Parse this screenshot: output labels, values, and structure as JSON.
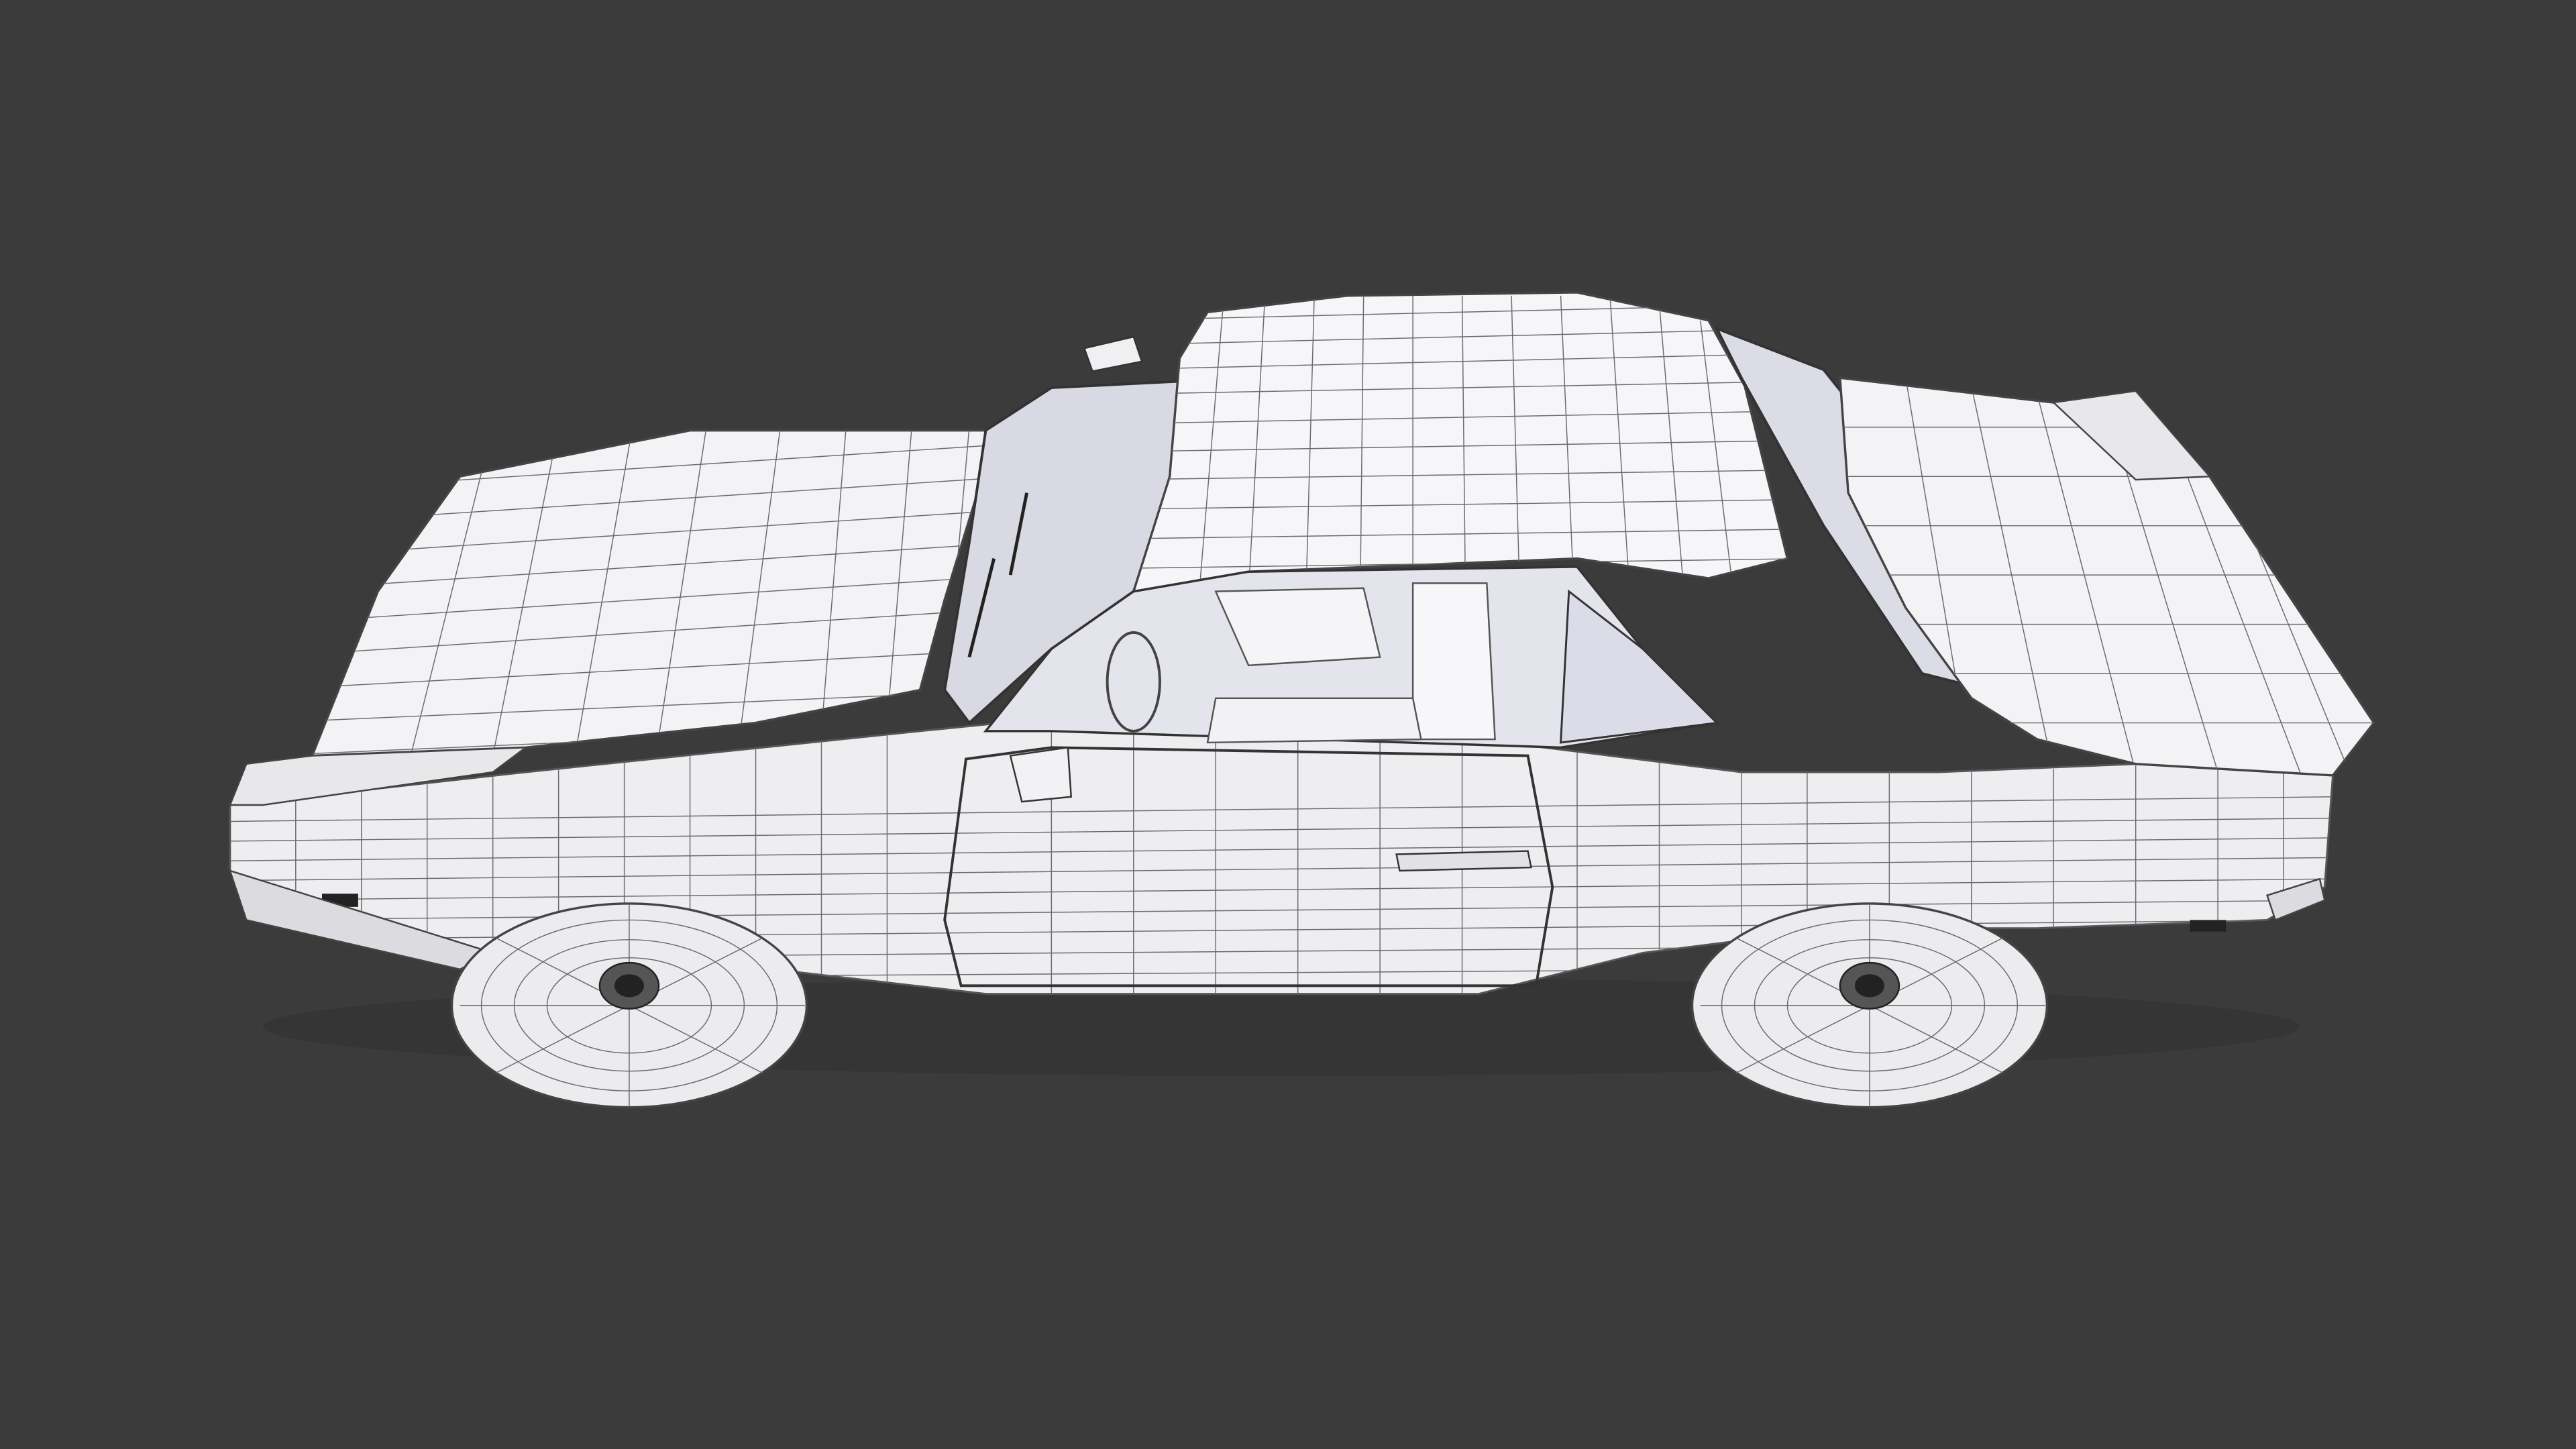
{
  "scene": {
    "background_color": "#3b3b3b",
    "model_fill": "#f4f4f6",
    "wire_color": "#4a4a4e",
    "shadow_color": "#c9c9cf"
  },
  "icons": {
    "car": "wireframe-car-render"
  }
}
